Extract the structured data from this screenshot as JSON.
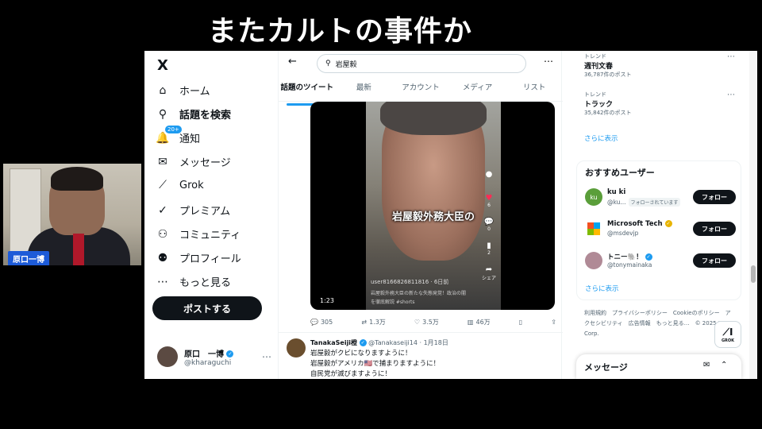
{
  "headline": "またカルトの事件か",
  "webcam": {
    "name_tag": "原口一博"
  },
  "nav": {
    "logo": "X",
    "items": [
      {
        "icon": "home-icon",
        "glyph": "⌂",
        "label": "ホーム"
      },
      {
        "icon": "search-icon",
        "glyph": "⚲",
        "label": "話題を検索"
      },
      {
        "icon": "bell-icon",
        "glyph": "🔔",
        "label": "通知",
        "badge": "20+"
      },
      {
        "icon": "mail-icon",
        "glyph": "✉",
        "label": "メッセージ"
      },
      {
        "icon": "grok-icon",
        "glyph": "⟋",
        "label": "Grok"
      },
      {
        "icon": "premium-icon",
        "glyph": "✓",
        "label": "プレミアム"
      },
      {
        "icon": "community-icon",
        "glyph": "⚇",
        "label": "コミュニティ"
      },
      {
        "icon": "profile-icon",
        "glyph": "⚉",
        "label": "プロフィール"
      },
      {
        "icon": "more-icon",
        "glyph": "⋯",
        "label": "もっと見る"
      }
    ],
    "post_button": "ポストする",
    "account": {
      "name": "原口　一博",
      "handle": "@kharaguchi"
    }
  },
  "center": {
    "search_value": "岩屋毅",
    "tabs": [
      "話題のツイート",
      "最新",
      "アカウント",
      "メディア",
      "リスト"
    ],
    "video": {
      "caption": "岩屋毅外務大臣の",
      "user": "user8166826811816 · 6日前",
      "desc": "岩屋毅外務大臣の新たな失態発覚！政治の闇を徹底解説 #shorts",
      "time": "1:23",
      "side_counts": [
        "",
        "6",
        "0",
        "2",
        "シェア"
      ]
    },
    "actions": {
      "replies": "305",
      "reposts": "1.3万",
      "likes": "3.5万",
      "views": "46万"
    },
    "tweet2": {
      "name": "TanakaSeiji橙",
      "handle": "@Tanakaseiji14",
      "date": "1月18日",
      "lines": [
        "岩屋毅がクビになりますように！",
        "岩屋毅がアメリカ🇺🇸で捕まりますように！",
        "自民党が滅びますように！"
      ]
    }
  },
  "right": {
    "trends": [
      {
        "label": "トレンド",
        "title": "週刊文春",
        "count": "36,787件のポスト"
      },
      {
        "label": "トレンド",
        "title": "トラック",
        "count": "35,842件のポスト"
      }
    ],
    "show_more": "さらに表示",
    "recommend_title": "おすすめユーザー",
    "users": [
      {
        "name": "ku ki",
        "handle": "@ku...",
        "pill": "フォローされています",
        "color": "#5a9e3a",
        "initials": "ku"
      },
      {
        "name": "Microsoft Tech",
        "handle": "@msdevjp",
        "pill": "",
        "color": "#ffffff",
        "initials": ""
      },
      {
        "name": "トニー🐘！",
        "handle": "@tonymainaka",
        "pill": "",
        "color": "#b08a96",
        "initials": ""
      }
    ],
    "follow_label": "フォロー",
    "footer": "利用規約　プライバシーポリシー　Cookieのポリシー　アクセシビリティ　広告情報　もっと見る…　© 2025 X Corp.",
    "grok_label": "GROK",
    "messages_title": "メッセージ"
  }
}
